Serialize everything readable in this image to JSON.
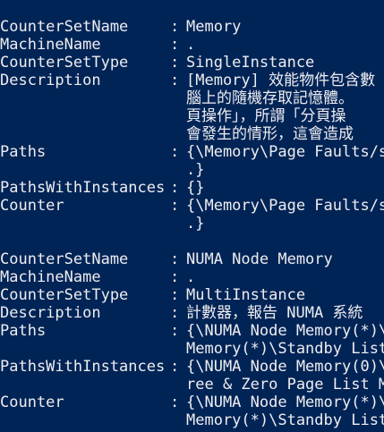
{
  "console": {
    "blocks": [
      {
        "rows": [
          {
            "key": "CounterSetName",
            "sep": ":",
            "value": "Memory"
          },
          {
            "key": "MachineName",
            "sep": ":",
            "value": "."
          },
          {
            "key": "CounterSetType",
            "sep": ":",
            "value": "SingleInstance"
          },
          {
            "key": "Description",
            "sep": ":",
            "value": "[Memory] 效能物件包含數",
            "continuation": [
              "腦上的隨機存取記憶體。",
              "頁操作」，所謂「分頁操",
              "會發生的情形，這會造成"
            ]
          },
          {
            "key": "Paths",
            "sep": ":",
            "value": "{\\Memory\\Page Faults/s",
            "continuation": [
              ".}"
            ]
          },
          {
            "key": "PathsWithInstances",
            "sep": ":",
            "value": "{}"
          },
          {
            "key": "Counter",
            "sep": ":",
            "value": "{\\Memory\\Page Faults/s",
            "continuation": [
              ".}"
            ]
          }
        ]
      },
      {
        "rows": [
          {
            "key": "CounterSetName",
            "sep": ":",
            "value": "NUMA Node Memory"
          },
          {
            "key": "MachineName",
            "sep": ":",
            "value": "."
          },
          {
            "key": "CounterSetType",
            "sep": ":",
            "value": "MultiInstance"
          },
          {
            "key": "Description",
            "sep": ":",
            "value": "計數器，報告 NUMA 系統"
          },
          {
            "key": "Paths",
            "sep": ":",
            "value": "{\\NUMA Node Memory(*)\\",
            "continuation": [
              "Memory(*)\\Standby List"
            ]
          },
          {
            "key": "PathsWithInstances",
            "sep": ":",
            "value": "{\\NUMA Node Memory(0)\\",
            "continuation": [
              "ree & Zero Page List M"
            ]
          },
          {
            "key": "Counter",
            "sep": ":",
            "value": "{\\NUMA Node Memory(*)\\",
            "continuation": [
              "Memory(*)\\Standby List"
            ]
          }
        ]
      }
    ]
  }
}
